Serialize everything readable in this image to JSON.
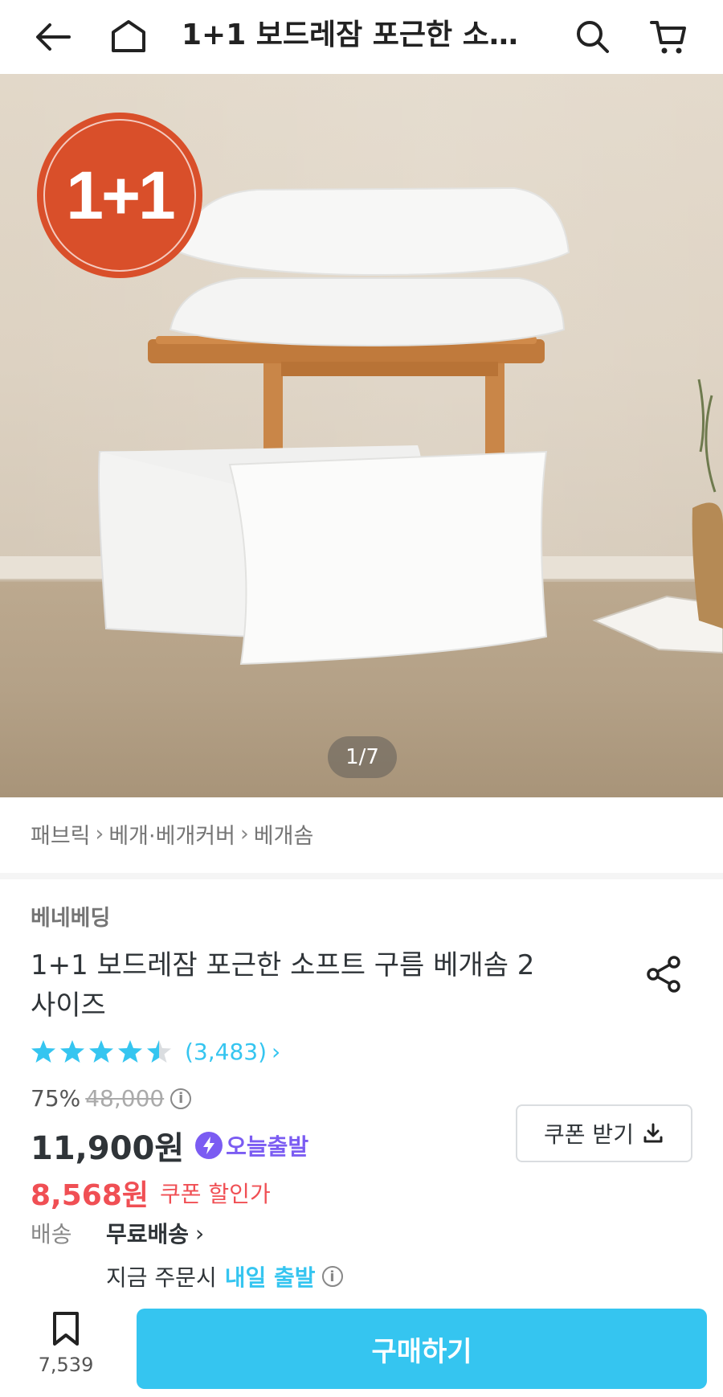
{
  "header": {
    "title": "1+1 보드레잠 포근한 소프…",
    "icons": [
      "back-arrow-icon",
      "home-icon",
      "search-icon",
      "cart-icon"
    ]
  },
  "hero": {
    "badge": "1+1",
    "counter": "1/7"
  },
  "breadcrumb": [
    "패브릭",
    "베개·베개커버",
    "베개솜"
  ],
  "product": {
    "brand": "베네베딩",
    "title": "1+1 보드레잠 포근한 소프트 구름 베개솜 2사이즈",
    "rating": 4.5,
    "review_count": "(3,483)",
    "discount_rate": "75%",
    "original_price": "48,000",
    "price": "11,900원",
    "today_ship": "오늘출발",
    "coupon_button": "쿠폰 받기",
    "coupon_price": "8,568원",
    "coupon_label": "쿠폰 할인가"
  },
  "shipping": {
    "label": "배송",
    "value": "무료배송",
    "sub_prefix": "지금 주문시",
    "sub_highlight": "내일 출발"
  },
  "bottom_bar": {
    "save_count": "7,539",
    "buy_label": "구매하기"
  },
  "colors": {
    "accent": "#35c5f0",
    "coupon_red": "#f04f54",
    "today_purple": "#7b5cf2",
    "badge_orange": "#d94f2a",
    "star": "#35c5f0"
  }
}
